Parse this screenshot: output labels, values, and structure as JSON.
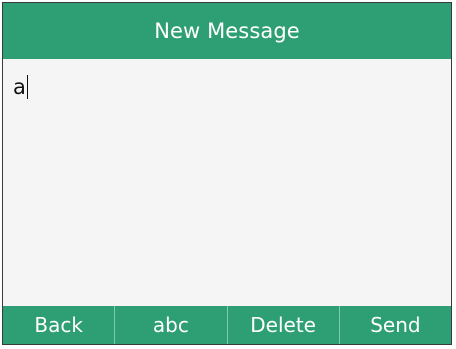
{
  "title": "New Message",
  "message": {
    "text": "a"
  },
  "softkeys": [
    {
      "label": "Back"
    },
    {
      "label": "abc"
    },
    {
      "label": "Delete"
    },
    {
      "label": "Send"
    }
  ],
  "colors": {
    "accent": "#2e9f75",
    "background": "#f5f5f5",
    "text": "#111111"
  }
}
